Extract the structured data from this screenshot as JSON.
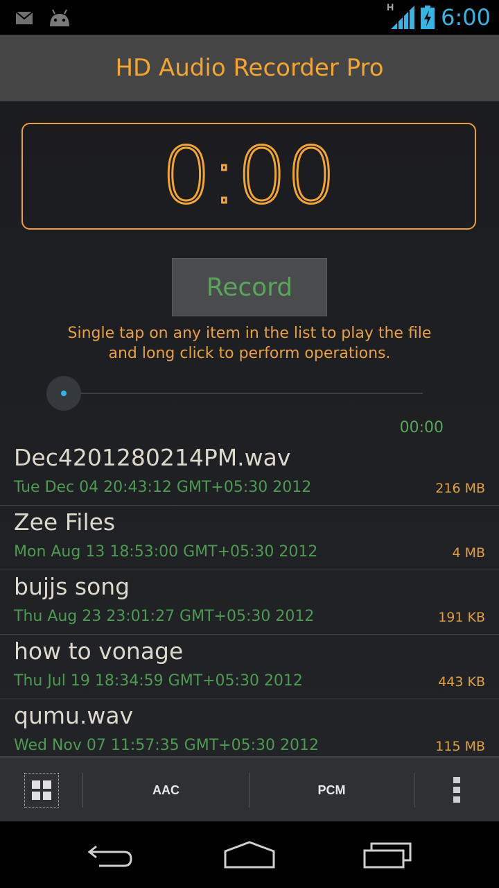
{
  "status_bar": {
    "time": "6:00",
    "network_label": "H",
    "icons": [
      "gmail-icon",
      "android-icon",
      "signal-icon",
      "battery-charging-icon"
    ]
  },
  "app": {
    "title": "HD Audio Recorder Pro"
  },
  "timer": {
    "value": "0:00"
  },
  "record_button": {
    "label": "Record"
  },
  "hint": {
    "line1": "Single tap on any item in the list to play the file",
    "line2": "and long click to perform operations."
  },
  "player": {
    "elapsed": "00:00",
    "progress": 0
  },
  "files": [
    {
      "name": "Dec4201280214PM.wav",
      "date": "Tue Dec 04 20:43:12 GMT+05:30 2012",
      "size": "216 MB"
    },
    {
      "name": "Zee Files",
      "date": "Mon Aug 13 18:53:00 GMT+05:30 2012",
      "size": "4 MB"
    },
    {
      "name": "bujjs song",
      "date": "Thu Aug 23 23:01:27 GMT+05:30 2012",
      "size": "191 KB"
    },
    {
      "name": "how to vonage",
      "date": "Thu Jul 19 18:34:59 GMT+05:30 2012",
      "size": "443 KB"
    },
    {
      "name": "qumu.wav",
      "date": "Wed Nov 07 11:57:35 GMT+05:30 2012",
      "size": "115 MB"
    }
  ],
  "action_bar": {
    "grid_icon": "grid-icon",
    "aac_label": "AAC",
    "pcm_label": "PCM",
    "overflow_icon": "overflow-menu-icon"
  },
  "nav_bar": {
    "icons": [
      "back-icon",
      "home-icon",
      "recent-apps-icon"
    ]
  },
  "colors": {
    "accent_orange": "#f2a531",
    "accent_green": "#5aa45c",
    "accent_blue": "#33b5e5"
  }
}
